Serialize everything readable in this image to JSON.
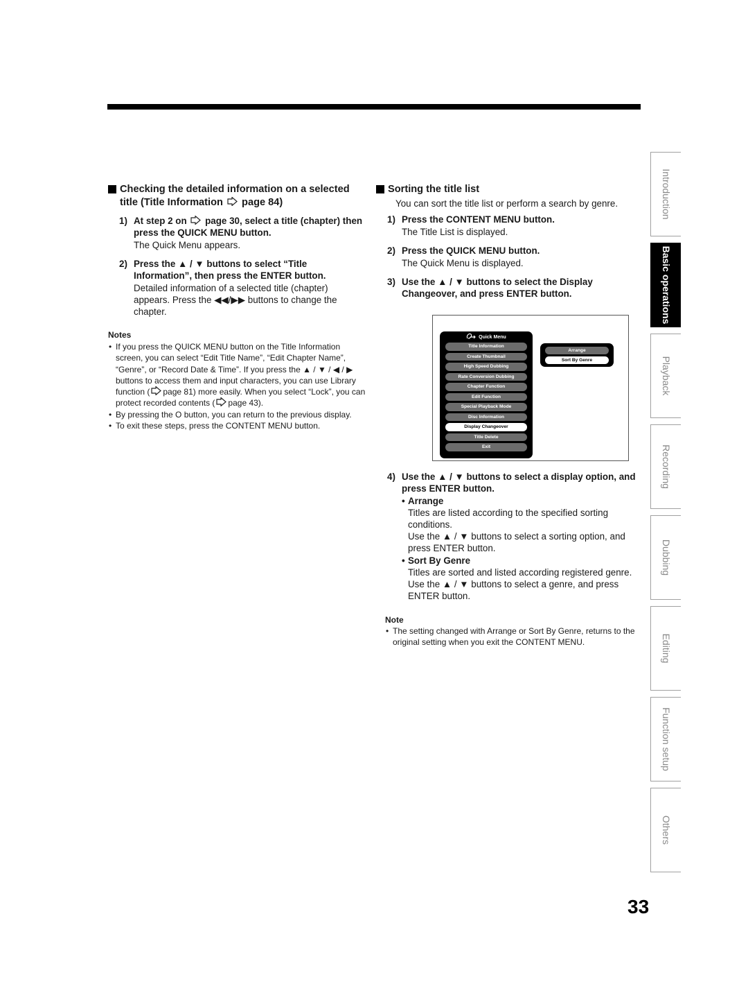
{
  "left": {
    "heading_part1": "Checking the detailed information on a selected title (Title Information",
    "heading_part2": "page 84)",
    "steps": [
      {
        "num": "1)",
        "bold_a": "At step 2 on",
        "bold_b": "page 30, select a title (chapter) then press the QUICK MENU button.",
        "desc": "The Quick Menu appears."
      },
      {
        "num": "2)",
        "bold": "Press the ▲ / ▼ buttons to select “Title Information”, then press the ENTER button.",
        "desc": "Detailed information of a selected title (chapter) appears. Press the ◀◀/▶▶ buttons to change the chapter."
      }
    ],
    "notes_title": "Notes",
    "notes": [
      {
        "text_a": "If you press the QUICK MENU button on the Title Information screen, you can select “Edit Title Name”, “Edit Chapter Name”, “Genre”, or “Record Date & Time”. If you press the ▲ / ▼ / ◀ / ▶ buttons to access them and input characters, you can use Library function (",
        "text_b": "page 81) more easily. When you select “Lock”, you can protect recorded contents (",
        "text_c": "page 43)."
      },
      {
        "text": "By pressing the O button, you can return to the previous display."
      },
      {
        "text": "To exit these steps, press the CONTENT MENU button."
      }
    ]
  },
  "right": {
    "heading": "Sorting the title list",
    "intro": "You can sort the title list or perform a search by genre.",
    "steps": [
      {
        "num": "1)",
        "bold": "Press the CONTENT MENU button.",
        "desc": "The Title List is displayed."
      },
      {
        "num": "2)",
        "bold": "Press the QUICK MENU button.",
        "desc": "The Quick Menu is displayed."
      },
      {
        "num": "3)",
        "bold": "Use the ▲ / ▼ buttons to select the Display Changeover, and press ENTER button."
      },
      {
        "num": "4)",
        "bold": "Use the ▲ / ▼ buttons to select a display option, and press ENTER button."
      }
    ],
    "options": [
      {
        "title": "Arrange",
        "desc1": "Titles are listed according to the specified sorting conditions.",
        "desc2": "Use the ▲ / ▼ buttons to select a sorting option, and press ENTER button."
      },
      {
        "title": "Sort By Genre",
        "desc1": "Titles are sorted and listed according registered genre. Use the ▲ / ▼ buttons to select a genre, and press ENTER button."
      }
    ],
    "note_title": "Note",
    "note": "The setting changed with Arrange or Sort By Genre, returns to the original setting when you exit the CONTENT MENU."
  },
  "screen": {
    "menu_title": "Quick Menu",
    "menu_items": [
      "Title Information",
      "Create Thumbnail",
      "High Speed Dubbing",
      "Rate Conversion  Dubbing",
      "Chapter Function",
      "Edit Function",
      "Special Playback Mode",
      "Disc Information",
      "Display Changeover",
      "Title Delete",
      "Exit"
    ],
    "selected_item": "Display Changeover",
    "submenu_items": [
      "Arrange",
      "Sort By Genre"
    ],
    "submenu_selected": "Sort By Genre"
  },
  "side_tabs": [
    {
      "label": "Introduction",
      "active": false
    },
    {
      "label": "Basic operations",
      "active": true
    },
    {
      "label": "Playback",
      "active": false
    },
    {
      "label": "Recording",
      "active": false
    },
    {
      "label": "Dubbing",
      "active": false
    },
    {
      "label": "Editing",
      "active": false
    },
    {
      "label": "Function setup",
      "active": false
    },
    {
      "label": "Others",
      "active": false
    }
  ],
  "page_number": "33"
}
